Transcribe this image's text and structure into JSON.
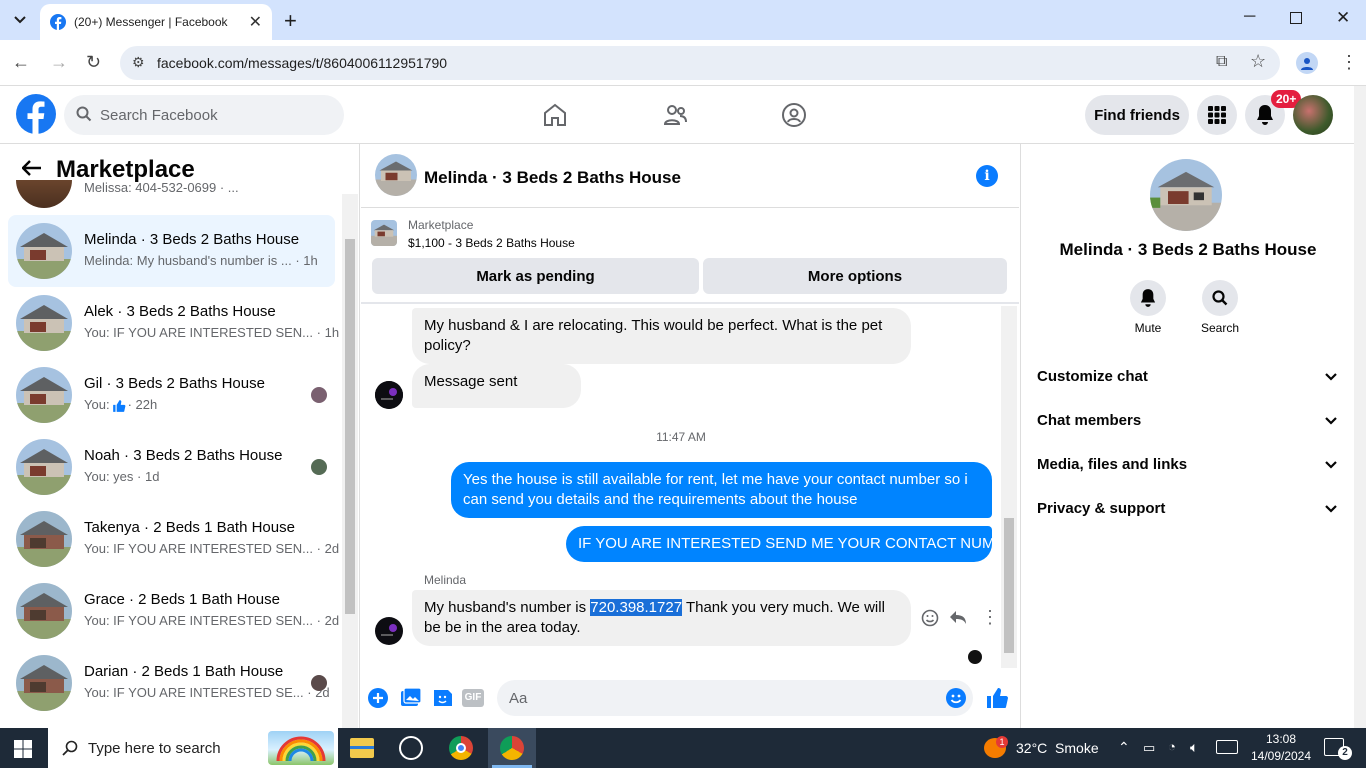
{
  "browser": {
    "tab_title": "(20+) Messenger | Facebook",
    "url": "facebook.com/messages/t/8604006112951790"
  },
  "fb": {
    "search_placeholder": "Search Facebook",
    "find_friends": "Find friends",
    "notif_badge": "20+"
  },
  "left": {
    "title": "Marketplace",
    "partial_top": "Melissa: 404-532-0699 · ...",
    "conversations": [
      {
        "title": "Melinda · 3 Beds 2 Baths House",
        "preview": "Melinda: My husband's number is ...",
        "time": "· 1h",
        "selected": true
      },
      {
        "title": "Alek · 3 Beds 2 Baths House",
        "preview": "You: IF YOU ARE INTERESTED SEN...",
        "time": "· 1h"
      },
      {
        "title": "Gil · 3 Beds 2 Baths House",
        "preview": "You:",
        "time": "· 22h"
      },
      {
        "title": "Noah · 3 Beds 2 Baths House",
        "preview": "You: yes",
        "time": "· 1d"
      },
      {
        "title": "Takenya · 2 Beds 1 Bath House",
        "preview": "You: IF YOU ARE INTERESTED SEN...",
        "time": "· 2d"
      },
      {
        "title": "Grace · 2 Beds 1 Bath House",
        "preview": "You: IF YOU ARE INTERESTED SEN...",
        "time": "· 2d"
      },
      {
        "title": "Darian · 2 Beds 1 Bath House",
        "preview": "You: IF YOU ARE INTERESTED SE...",
        "time": "· 2d"
      }
    ]
  },
  "chat": {
    "header_title": "Melinda · 3 Beds 2 Baths House",
    "listing_source": "Marketplace",
    "listing_info": "$1,100 - 3 Beds 2 Baths House",
    "mark_pending": "Mark as pending",
    "more_options": "More options",
    "msg1": "My husband & I are relocating. This would be perfect. What is the pet policy?",
    "msg2": "Message sent",
    "timestamp": "11:47 AM",
    "msg3": "Yes the house is still available for rent, let me have your contact number so i can send you details and the requirements about the house",
    "msg4": "IF YOU ARE INTERESTED SEND ME YOUR CONTACT NUMBER",
    "sender_name": "Melinda",
    "msg5_pre": "My husband's number is ",
    "msg5_highlight": "720.398.1727",
    "msg5_post": " Thank you very much. We will be be in the area today.",
    "composer_placeholder": "Aa",
    "gif_label": "GIF"
  },
  "right": {
    "name": "Melinda · 3 Beds 2 Baths House",
    "mute": "Mute",
    "search": "Search",
    "menu": [
      "Customize chat",
      "Chat members",
      "Media, files and links",
      "Privacy & support"
    ]
  },
  "taskbar": {
    "search_placeholder": "Type here to search",
    "weather": "32°C  Smoke",
    "time": "13:08",
    "date": "14/09/2024",
    "notif_count": "2",
    "weather_badge": "1"
  }
}
